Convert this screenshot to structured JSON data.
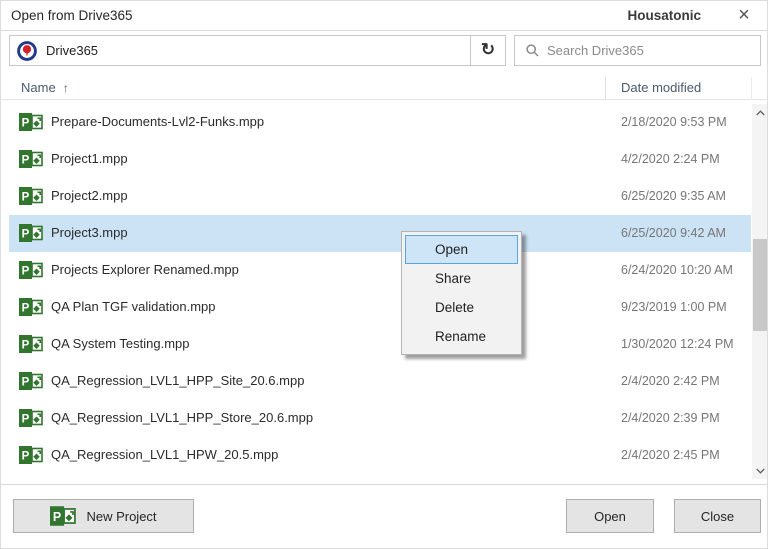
{
  "window": {
    "title": "Open from Drive365",
    "brand": "Housatonic",
    "close_glyph": "×"
  },
  "toolbar": {
    "location_value": "Drive365",
    "refresh_glyph": "↻",
    "search_placeholder": "Search Drive365"
  },
  "list": {
    "name_header": "Name",
    "sort_indicator": "↑",
    "date_header": "Date modified",
    "rows": [
      {
        "name": "Prepare-Documents-Lvl2-Funks.mpp",
        "date": "2/18/2020 9:53 PM",
        "selected": false
      },
      {
        "name": "Project1.mpp",
        "date": "4/2/2020 2:24 PM",
        "selected": false
      },
      {
        "name": "Project2.mpp",
        "date": "6/25/2020 9:35 AM",
        "selected": false
      },
      {
        "name": "Project3.mpp",
        "date": "6/25/2020 9:42 AM",
        "selected": true
      },
      {
        "name": "Projects Explorer Renamed.mpp",
        "date": "6/24/2020 10:20 AM",
        "selected": false
      },
      {
        "name": "QA Plan TGF validation.mpp",
        "date": "9/23/2019 1:00 PM",
        "selected": false
      },
      {
        "name": "QA System Testing.mpp",
        "date": "1/30/2020 12:24 PM",
        "selected": false
      },
      {
        "name": "QA_Regression_LVL1_HPP_Site_20.6.mpp",
        "date": "2/4/2020 2:42 PM",
        "selected": false
      },
      {
        "name": "QA_Regression_LVL1_HPP_Store_20.6.mpp",
        "date": "2/4/2020 2:39 PM",
        "selected": false
      },
      {
        "name": "QA_Regression_LVL1_HPW_20.5.mpp",
        "date": "2/4/2020 2:45 PM",
        "selected": false
      }
    ]
  },
  "context_menu": {
    "items": [
      {
        "label": "Open",
        "highlighted": true
      },
      {
        "label": "Share",
        "highlighted": false
      },
      {
        "label": "Delete",
        "highlighted": false
      },
      {
        "label": "Rename",
        "highlighted": false
      }
    ]
  },
  "footer": {
    "new_project_label": "New Project",
    "open_label": "Open",
    "close_label": "Close"
  },
  "colors": {
    "selection_blue": "#cbe3f5",
    "menu_highlight": "#cde5f7",
    "menu_highlight_border": "#58a6de",
    "project_green": "#31752f",
    "logo_blue": "#1e3c8c",
    "logo_red": "#d6202a"
  }
}
